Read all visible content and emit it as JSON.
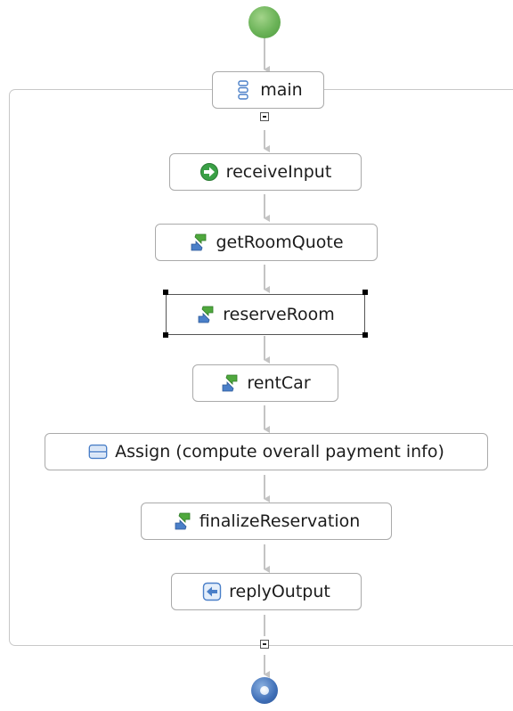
{
  "diagram": {
    "start": {
      "icon": "start-node"
    },
    "scope": {
      "label": "main",
      "icon": "sequence-icon"
    },
    "activities": [
      {
        "label": "receiveInput",
        "icon": "receive-icon"
      },
      {
        "label": "getRoomQuote",
        "icon": "invoke-icon"
      },
      {
        "label": "reserveRoom",
        "icon": "invoke-icon",
        "selected": true
      },
      {
        "label": "rentCar",
        "icon": "invoke-icon"
      },
      {
        "label": "Assign (compute overall payment info)",
        "icon": "assign-icon"
      },
      {
        "label": "finalizeReservation",
        "icon": "invoke-icon"
      },
      {
        "label": "replyOutput",
        "icon": "reply-icon"
      }
    ],
    "end": {
      "icon": "end-node"
    },
    "colors": {
      "connector": "#c4c4c4",
      "start": "#6bb358",
      "end": "#3f6fb7",
      "receive": "#3aa046",
      "invoke_green": "#4fa83d",
      "invoke_blue": "#4a7fc8",
      "assign": "#4a7fc8"
    }
  }
}
